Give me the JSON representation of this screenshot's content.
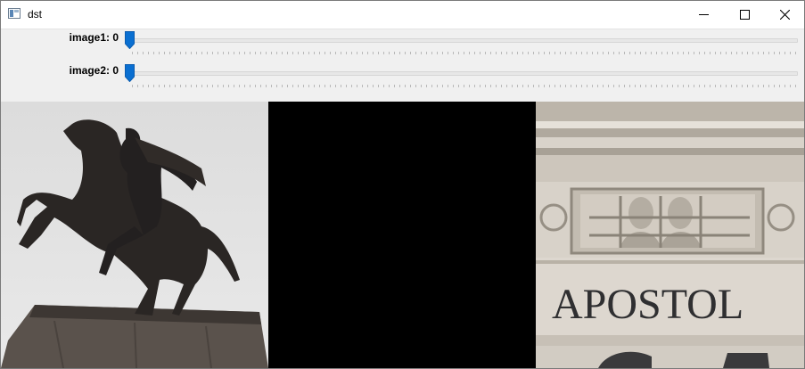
{
  "window": {
    "title": "dst",
    "icon": "app-window-icon",
    "controls": [
      "minimize-icon",
      "maximize-icon",
      "close-icon"
    ]
  },
  "trackbars": [
    {
      "label": "image1: 0",
      "value": 0
    },
    {
      "label": "image2: 0",
      "value": 0
    }
  ],
  "colors": {
    "thumb": "#0a6fd1",
    "titlebar": "#ffffff",
    "panel": "#f0f0f0"
  },
  "images": {
    "pane1": "equestrian-statue-photo",
    "pane2": "black-image",
    "pane3": "stone-facade-with-apostolic-relief",
    "facade_text": "APOSTOL"
  }
}
